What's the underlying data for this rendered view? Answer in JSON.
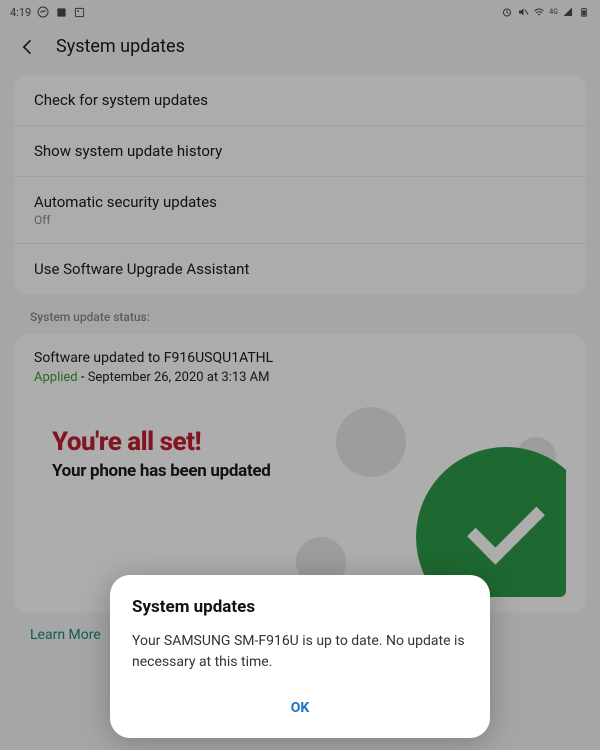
{
  "statusbar": {
    "time": "4:19",
    "icons_left": [
      "messenger-icon",
      "app-icon",
      "image-icon"
    ],
    "icons_right": [
      "alarm-icon",
      "mute-icon",
      "wifi-icon",
      "4g-icon",
      "signal-icon",
      "battery-icon"
    ]
  },
  "header": {
    "title": "System updates"
  },
  "options": [
    {
      "title": "Check for system updates",
      "sub": ""
    },
    {
      "title": "Show system update history",
      "sub": ""
    },
    {
      "title": "Automatic security updates",
      "sub": "Off"
    },
    {
      "title": "Use Software Upgrade Assistant",
      "sub": ""
    }
  ],
  "status_section": {
    "label": "System update status:",
    "line1": "Software updated to F916USQU1ATHL",
    "applied_label": "Applied",
    "separator": " - ",
    "date": "September 26, 2020 at 3:13 AM"
  },
  "banner": {
    "title": "You're all set!",
    "subtitle": "Your phone has been updated"
  },
  "learn_more": "Learn More",
  "dialog": {
    "title": "System updates",
    "body": "Your SAMSUNG SM-F916U is up to date. No update is necessary at this time.",
    "ok": "OK"
  }
}
